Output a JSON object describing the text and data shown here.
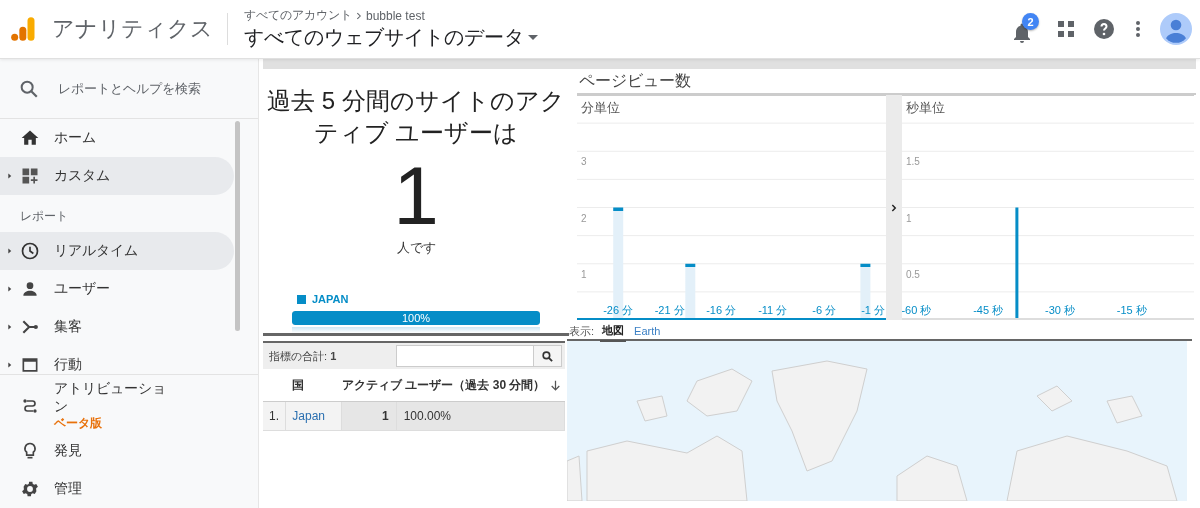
{
  "header": {
    "product": "アナリティクス",
    "breadcrumb": [
      "すべてのアカウント",
      "bubble test"
    ],
    "view": "すべてのウェブサイトのデータ",
    "notification_count": "2"
  },
  "sidebar": {
    "search": {
      "placeholder": "レポートとヘルプを検索"
    },
    "items": [
      {
        "kind": "item",
        "label": "ホーム",
        "expandable": false,
        "selected": false
      },
      {
        "kind": "item",
        "label": "カスタム",
        "expandable": true,
        "selected": true
      },
      {
        "kind": "section",
        "label": "レポート"
      },
      {
        "kind": "item",
        "label": "リアルタイム",
        "expandable": true,
        "selected": true
      },
      {
        "kind": "item",
        "label": "ユーザー",
        "expandable": true,
        "selected": false
      },
      {
        "kind": "item",
        "label": "集客",
        "expandable": true,
        "selected": false
      },
      {
        "kind": "item",
        "label": "行動",
        "expandable": true,
        "selected": false
      }
    ],
    "footer_items": [
      {
        "label": "アトリビューション",
        "badge": "ベータ版"
      },
      {
        "label": "発見"
      },
      {
        "label": "管理"
      }
    ]
  },
  "active_users": {
    "title": "過去 5 分間のサイトのアクティブ ユーザーは",
    "count": "1",
    "unit": "人です",
    "legend": [
      {
        "label": "JAPAN",
        "color": "#058dc7"
      }
    ],
    "bar": {
      "label": "100%",
      "level": 1
    }
  },
  "pageviews": {
    "title": "ページビュー数",
    "charts": [
      {
        "chart_data": {
          "type": "bar",
          "title": "分単位",
          "x": [
            -26,
            -19,
            -2
          ],
          "values": [
            2,
            1,
            1
          ],
          "xlim": [
            -30,
            0
          ],
          "ylim": [
            0,
            4
          ],
          "grid": true,
          "yticks": [
            1,
            2,
            3
          ],
          "xticks": [
            {
              "value": -26,
              "label": "-26 分"
            },
            {
              "value": -21,
              "label": "-21 分"
            },
            {
              "value": -16,
              "label": "-16 分"
            },
            {
              "value": -11,
              "label": "-11 分"
            },
            {
              "value": -6,
              "label": "-6 分"
            },
            {
              "value": -1,
              "label": "-1 分"
            }
          ]
        }
      },
      {
        "chart_data": {
          "type": "bar",
          "title": "秒単位",
          "x": [
            -39
          ],
          "values": [
            1
          ],
          "xlim": [
            -63,
            -2
          ],
          "ylim": [
            0,
            2
          ],
          "grid": true,
          "yticks": [
            0.5,
            1,
            1.5
          ],
          "xticks": [
            {
              "value": -60,
              "label": "-60 秒"
            },
            {
              "value": -45,
              "label": "-45 秒"
            },
            {
              "value": -30,
              "label": "-30 秒"
            },
            {
              "value": -15,
              "label": "-15 秒"
            }
          ]
        }
      }
    ]
  },
  "map_view": {
    "label": "表示:",
    "tabs": [
      {
        "label": "地図",
        "selected": true
      },
      {
        "label": "Earth",
        "selected": false
      }
    ]
  },
  "table": {
    "total": "指標の合計: **1**",
    "columns": [
      "国",
      "アクティブ ユーザー（過去 30 分間）"
    ],
    "rows": [
      {
        "index": "1.",
        "country": "Japan",
        "users": "1",
        "share": "100.00%"
      }
    ]
  }
}
